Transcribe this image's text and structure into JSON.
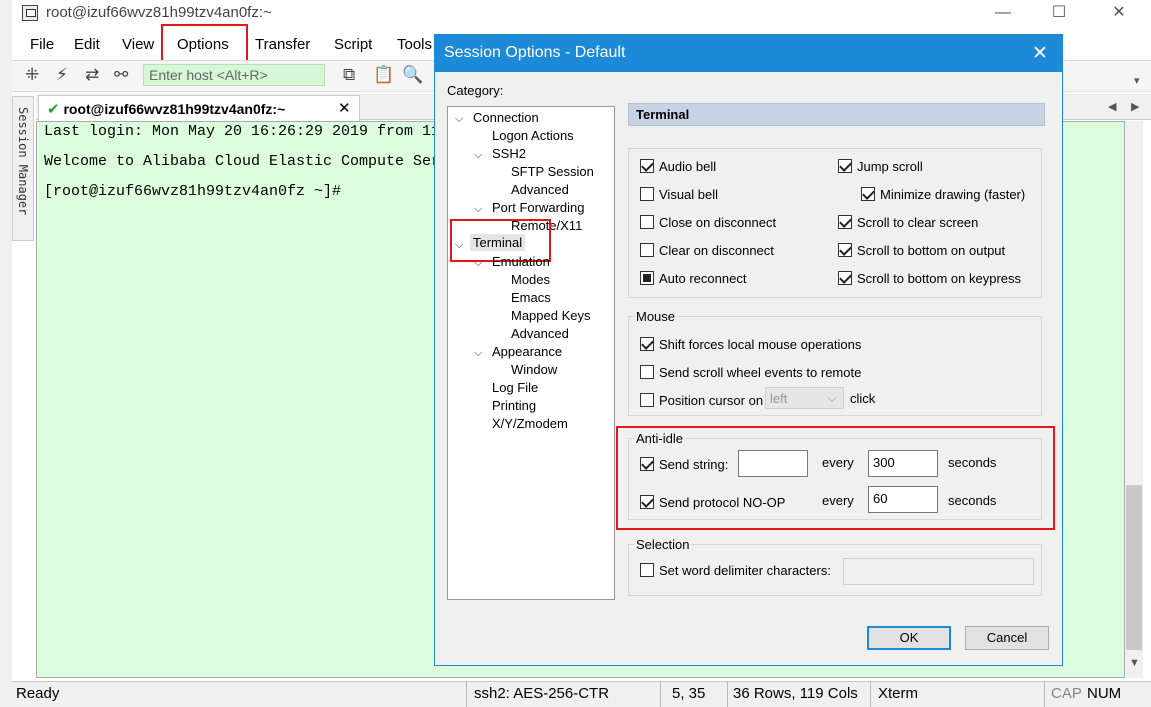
{
  "window": {
    "title": "root@izuf66wvz81h99tzv4an0fz:~",
    "minimize": "—",
    "maximize": "☐",
    "close": "✕"
  },
  "menu": [
    "File",
    "Edit",
    "View",
    "Options",
    "Transfer",
    "Script",
    "Tools"
  ],
  "toolbar": {
    "host_placeholder": "Enter host <Alt+R>"
  },
  "tab": {
    "label": "root@izuf66wvz81h99tzv4an0fz:~",
    "close": "✕"
  },
  "session_manager_label": "Session Manager",
  "terminal": {
    "lines": [
      "Last login: Mon May 20 16:26:29 2019 from 11",
      "Welcome to Alibaba Cloud Elastic Compute Ser",
      "[root@izuf66wvz81h99tzv4an0fz ~]#"
    ]
  },
  "status": {
    "ready": "Ready",
    "cipher": "ssh2: AES-256-CTR",
    "position": "5,  35",
    "size": "36 Rows, 119 Cols",
    "term": "Xterm",
    "cap": "CAP",
    "num": "NUM"
  },
  "dialog": {
    "title": "Session Options - Default",
    "close": "✕",
    "category_label": "Category:",
    "tree": [
      {
        "label": "Connection",
        "level": 0,
        "expanded": true
      },
      {
        "label": "Logon Actions",
        "level": 1
      },
      {
        "label": "SSH2",
        "level": 1,
        "expanded": true
      },
      {
        "label": "SFTP Session",
        "level": 2
      },
      {
        "label": "Advanced",
        "level": 2
      },
      {
        "label": "Port Forwarding",
        "level": 1,
        "expanded": true
      },
      {
        "label": "Remote/X11",
        "level": 2
      },
      {
        "label": "Terminal",
        "level": 0,
        "expanded": true,
        "selected": true
      },
      {
        "label": "Emulation",
        "level": 1,
        "expanded": true
      },
      {
        "label": "Modes",
        "level": 2
      },
      {
        "label": "Emacs",
        "level": 2
      },
      {
        "label": "Mapped Keys",
        "level": 2
      },
      {
        "label": "Advanced",
        "level": 2
      },
      {
        "label": "Appearance",
        "level": 1,
        "expanded": true
      },
      {
        "label": "Window",
        "level": 2
      },
      {
        "label": "Log File",
        "level": 1
      },
      {
        "label": "Printing",
        "level": 1
      },
      {
        "label": "X/Y/Zmodem",
        "level": 1
      }
    ],
    "section_header": "Terminal",
    "options_left": [
      {
        "label": "Audio bell",
        "state": "checked"
      },
      {
        "label": "Visual bell",
        "state": "unchecked"
      },
      {
        "label": "Close on disconnect",
        "state": "unchecked"
      },
      {
        "label": "Clear on disconnect",
        "state": "unchecked"
      },
      {
        "label": "Auto reconnect",
        "state": "indeterminate"
      }
    ],
    "options_right": [
      {
        "label": "Jump scroll",
        "state": "checked"
      },
      {
        "label": "Minimize drawing (faster)",
        "state": "checked"
      },
      {
        "label": "Scroll to clear screen",
        "state": "checked"
      },
      {
        "label": "Scroll to bottom on output",
        "state": "checked"
      },
      {
        "label": "Scroll to bottom on keypress",
        "state": "checked"
      }
    ],
    "mouse": {
      "title": "Mouse",
      "shift_forces": "Shift forces local mouse operations",
      "send_scroll": "Send scroll wheel events to remote",
      "position_cursor": "Position cursor on",
      "position_value": "left",
      "click": "click"
    },
    "anti_idle": {
      "title": "Anti-idle",
      "send_string": "Send string:",
      "send_string_value": "",
      "every1": "every",
      "seconds1_value": "300",
      "seconds1": "seconds",
      "send_noop": "Send protocol NO-OP",
      "every2": "every",
      "seconds2_value": "60",
      "seconds2": "seconds"
    },
    "selection": {
      "title": "Selection",
      "delimiter": "Set word delimiter characters:",
      "delimiter_value": ""
    },
    "ok": "OK",
    "cancel": "Cancel"
  },
  "colors": {
    "dialog_accent": "#1c8ad6",
    "terminal_bg": "#dcfedc",
    "highlight_red": "#e3161b"
  }
}
